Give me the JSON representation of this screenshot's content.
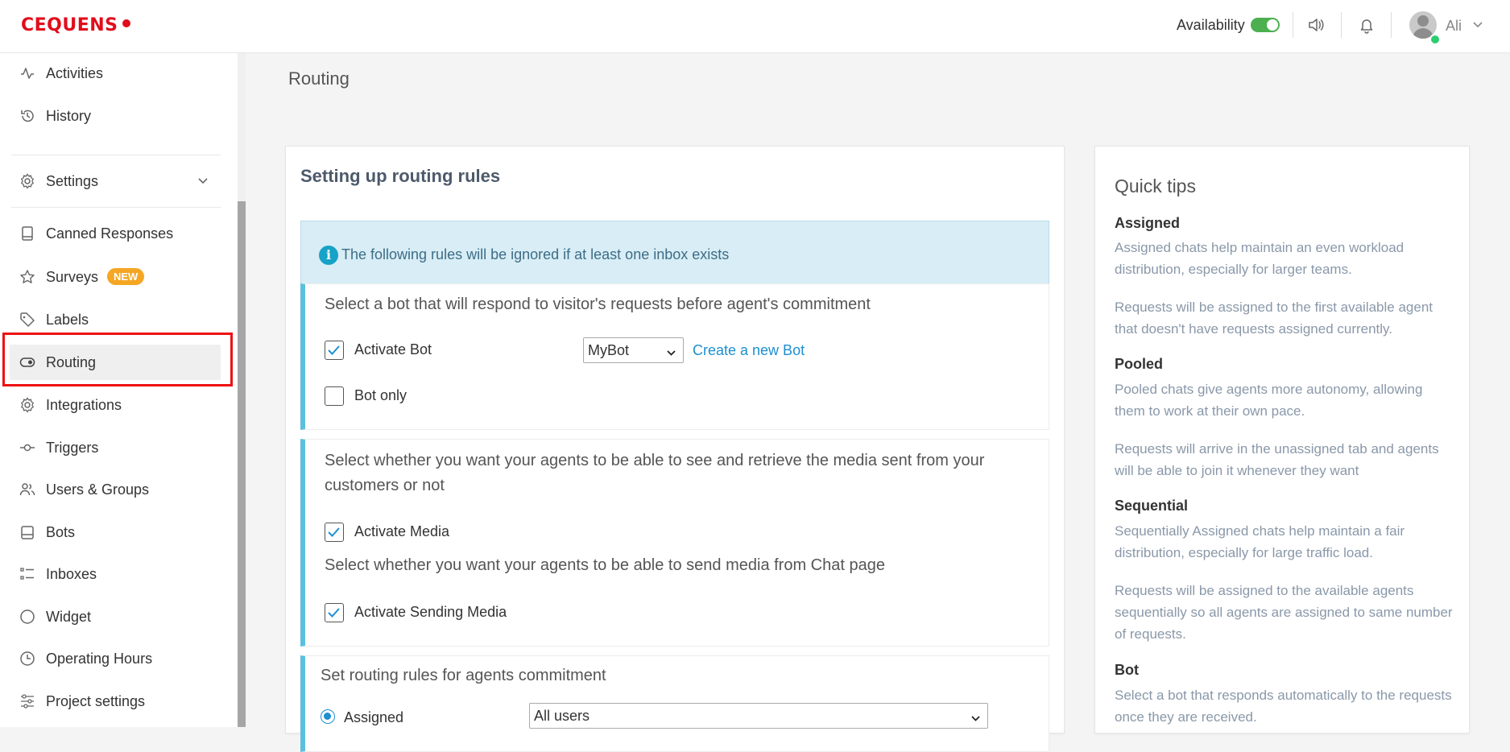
{
  "header": {
    "logo": "CEQUENS",
    "availability_label": "Availability",
    "availability_on": true,
    "user_name": "Ali",
    "icons": [
      "speaker-icon",
      "bell-icon",
      "avatar"
    ]
  },
  "sidebar": {
    "items": [
      {
        "label": "Activities",
        "icon": "activity-icon"
      },
      {
        "label": "History",
        "icon": "history-icon"
      },
      {
        "label": "Settings",
        "icon": "gear-icon"
      },
      {
        "label": "Canned Responses",
        "icon": "book-icon"
      },
      {
        "label": "Surveys",
        "icon": "star-icon",
        "badge": "NEW"
      },
      {
        "label": "Labels",
        "icon": "tag-icon"
      },
      {
        "label": "Routing",
        "icon": "toggle-icon",
        "active": true
      },
      {
        "label": "Integrations",
        "icon": "gear-icon"
      },
      {
        "label": "Triggers",
        "icon": "trigger-icon"
      },
      {
        "label": "Users & Groups",
        "icon": "users-icon"
      },
      {
        "label": "Bots",
        "icon": "bot-icon"
      },
      {
        "label": "Inboxes",
        "icon": "list-icon"
      },
      {
        "label": "Widget",
        "icon": "circle-icon"
      },
      {
        "label": "Operating Hours",
        "icon": "clock-icon"
      },
      {
        "label": "Project settings",
        "icon": "sliders-icon"
      }
    ]
  },
  "main": {
    "page_title": "Routing",
    "card_title": "Setting up routing rules",
    "info_text": "The following rules will be ignored if at least one inbox exists",
    "bot_section": {
      "text": "Select a bot that will respond to visitor's requests before agent's commitment",
      "activate_bot_label": "Activate Bot",
      "activate_bot_checked": true,
      "bot_select_value": "MyBot",
      "create_bot_link": "Create a new Bot",
      "bot_only_label": "Bot only",
      "bot_only_checked": false
    },
    "media_section": {
      "text": "Select whether you want your agents to be able to see and retrieve the media sent from your customers or not",
      "activate_media_label": "Activate Media",
      "send_text": "Select whether you want your agents to be able to send media from Chat page",
      "activate_sending_label": "Activate Sending Media"
    },
    "commit_section": {
      "text": "Set routing rules for agents commitment",
      "assigned_label": "Assigned",
      "users_select_value": "All users"
    }
  },
  "tips": {
    "title": "Quick tips",
    "assigned_head": "Assigned",
    "assigned_p1": "Assigned chats help maintain an even workload distribution, especially for larger teams.",
    "assigned_p2": "Requests will be assigned to the first available agent that doesn't have requests assigned currently.",
    "pooled_head": "Pooled",
    "pooled_p1": "Pooled chats give agents more autonomy, allowing them to work at their own pace.",
    "pooled_p2": "Requests will arrive in the unassigned tab and agents will be able to join it whenever they want",
    "sequential_head": "Sequential",
    "sequential_p1": "Sequentially Assigned chats help maintain a fair distribution, especially for large traffic load.",
    "sequential_p2": "Requests will be assigned to the available agents sequentially so all agents are assigned to same number of requests.",
    "bot_head": "Bot",
    "bot_p1": "Select a bot that responds automatically to the requests once they are received."
  },
  "colors": {
    "brand": "#e10d1b",
    "accent": "#1d8fd1",
    "section_border": "#5bc0de",
    "badge": "#f5a623",
    "toggle_on": "#4caf50"
  }
}
